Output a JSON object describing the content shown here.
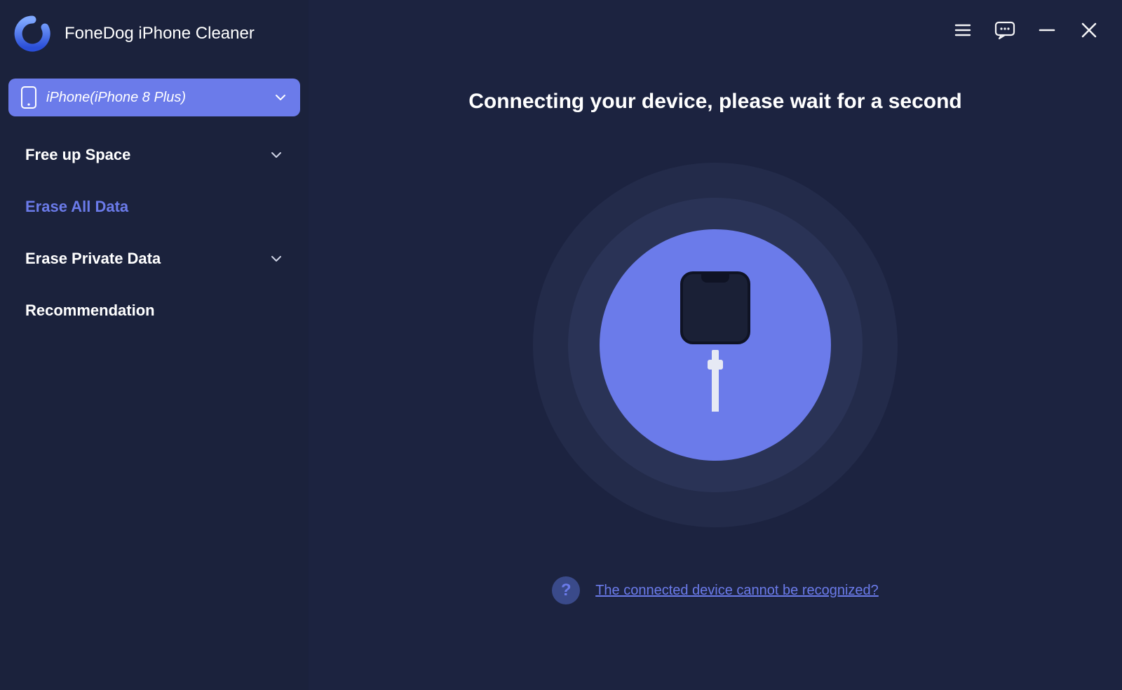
{
  "app": {
    "title": "FoneDog iPhone Cleaner"
  },
  "device": {
    "label": "iPhone(iPhone 8 Plus)"
  },
  "nav": {
    "items": [
      {
        "label": "Free up Space",
        "expandable": true
      },
      {
        "label": "Erase All Data",
        "active": true
      },
      {
        "label": "Erase Private Data",
        "expandable": true
      },
      {
        "label": "Recommendation"
      }
    ]
  },
  "main": {
    "headline": "Connecting your device, please wait for a second",
    "help_link": "The connected device cannot be recognized?"
  },
  "icons": {
    "menu": "menu-icon",
    "feedback": "feedback-icon",
    "minimize": "minimize-icon",
    "close": "close-icon"
  },
  "colors": {
    "accent": "#6b7bea",
    "bg": "#1c2340",
    "sidebar": "#1b223c"
  }
}
